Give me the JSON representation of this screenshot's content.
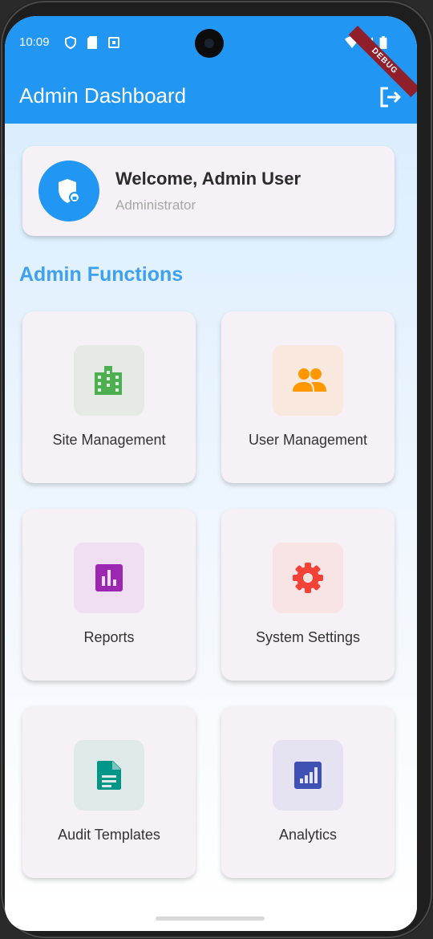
{
  "status_bar": {
    "time": "10:09",
    "icons": [
      "shield-icon",
      "sim-icon",
      "notification-icon",
      "wifi-icon",
      "signal-icon",
      "battery-icon"
    ],
    "debug_banner": "DEBUG"
  },
  "app_bar": {
    "title": "Admin Dashboard",
    "action_icon": "logout-icon",
    "color": "#2196f3"
  },
  "welcome": {
    "title": "Welcome, Admin User",
    "role": "Administrator",
    "avatar_icon": "admin-shield-icon"
  },
  "section": {
    "title": "Admin Functions"
  },
  "functions": [
    {
      "label": "Site Management",
      "icon": "building-icon",
      "color": "#4caf50",
      "bg": "#e6eae4"
    },
    {
      "label": "User Management",
      "icon": "people-icon",
      "color": "#ff9800",
      "bg": "#f8e8dd"
    },
    {
      "label": "Reports",
      "icon": "bar-chart-icon",
      "color": "#9c27b0",
      "bg": "#f0def3"
    },
    {
      "label": "System Settings",
      "icon": "gear-icon",
      "color": "#f44336",
      "bg": "#f8e3e5"
    },
    {
      "label": "Audit Templates",
      "icon": "document-icon",
      "color": "#009688",
      "bg": "#e0e9e9"
    },
    {
      "label": "Analytics",
      "icon": "analytics-icon",
      "color": "#3f51b5",
      "bg": "#e5e3f2"
    }
  ]
}
